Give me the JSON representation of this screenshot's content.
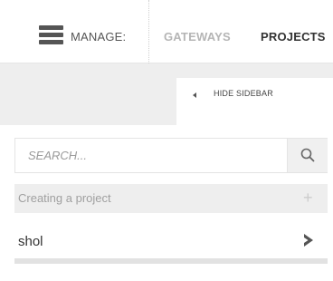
{
  "topbar": {
    "manage_label": "MANAGE:",
    "tabs": [
      {
        "label": "GATEWAYS",
        "active": false
      },
      {
        "label": "PROJECTS",
        "active": true
      }
    ]
  },
  "sidebar": {
    "hide_label": "HIDE SIDEBAR",
    "search": {
      "placeholder": "SEARCH...",
      "value": ""
    },
    "create_label": "Creating a project",
    "projects": [
      {
        "label": "shol"
      }
    ]
  },
  "icons": {
    "menu": "hamburger-icon",
    "hide": "caret-left-icon",
    "search": "search-icon",
    "create": "plus-icon",
    "open": "chevron-right-icon"
  },
  "colors": {
    "text_dark": "#333333",
    "text_muted": "#b5b5b5",
    "band_gray": "#eeeeee"
  }
}
